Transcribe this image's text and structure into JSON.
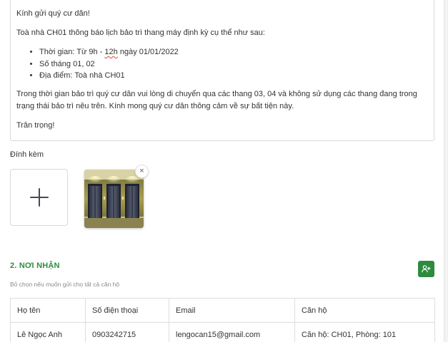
{
  "message": {
    "greeting": "Kính gửi quý cư dân!",
    "intro": "Toà nhà CH01 thông báo lịch bảo trì thang máy định kỳ cụ thể như sau:",
    "time_prefix": "Thời gian: Từ 9h - ",
    "time_misspelled": "12h",
    "time_suffix": " ngày 01/01/2022",
    "bullets": [
      "Số tháng 01, 02",
      "Địa điểm: Toà nhà CH01"
    ],
    "body": "Trong thời gian bảo trì quý cư dân vui lòng di chuyển qua các thang 03, 04 và không sử dụng các thang đang trong trạng thái bảo trì nêu trên. Kính mong quý cư dân thông cảm về sự bất tiện này.",
    "closing": "Trân trọng!"
  },
  "attachments": {
    "label": "Đính kèm",
    "add_icon": "plus-icon",
    "remove_symbol": "×",
    "remove_icon": "close-icon"
  },
  "recipients": {
    "title": "2. NƠI NHẬN",
    "hint": "Bỏ chọn nếu muốn gửi cho tất cả căn hộ",
    "add_icon": "add-user-icon",
    "accent_color": "#2e8b3e",
    "columns": [
      "Họ tên",
      "Số điện thoại",
      "Email",
      "Căn hộ"
    ],
    "rows": [
      [
        "Lê Ngọc Anh",
        "0903242715",
        "lengocan15@gmail.com",
        "Căn hộ: CH01, Phòng: 101"
      ]
    ]
  }
}
